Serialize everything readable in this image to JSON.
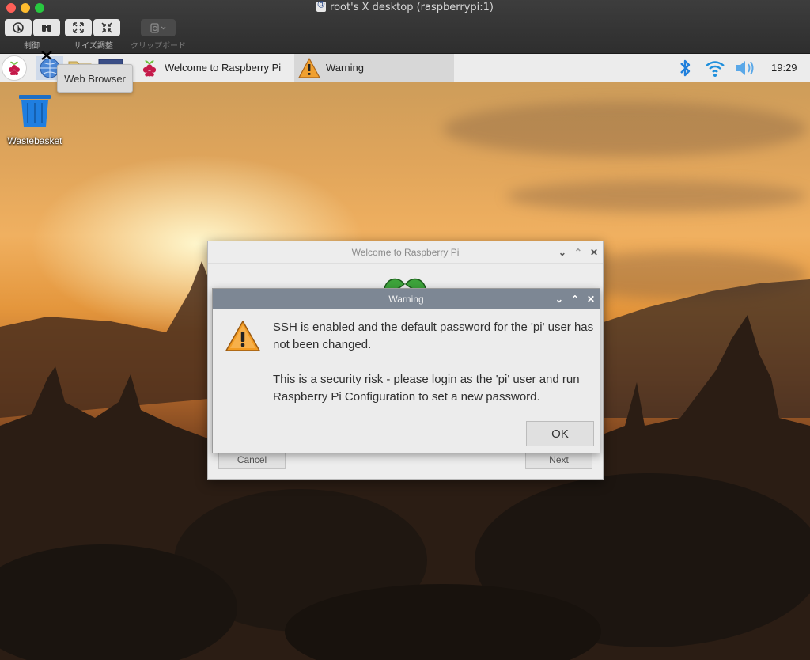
{
  "host_window": {
    "title": "root's X desktop (raspberrypi:1)",
    "toolbar": {
      "control_label": "制御",
      "resize_label": "サイズ調整",
      "clipboard_label": "クリップボード"
    }
  },
  "panel": {
    "tooltip": "Web Browser",
    "tasks": [
      {
        "label": "Welcome to Raspberry Pi"
      },
      {
        "label": "Warning"
      }
    ],
    "clock": "19:29"
  },
  "desktop": {
    "icons": [
      {
        "label": "Wastebasket"
      }
    ]
  },
  "welcome_window": {
    "title": "Welcome to Raspberry Pi",
    "cancel_label": "Cancel",
    "next_label": "Next"
  },
  "warning_dialog": {
    "title": "Warning",
    "message_1": "SSH is enabled and the default password for the 'pi' user has not been changed.",
    "message_2": "This is a security risk - please login as the 'pi' user and run Raspberry Pi Configuration to set a new password.",
    "ok_label": "OK"
  },
  "colors": {
    "warning_titlebar": "#7d8794",
    "bluetooth": "#1f7fdc",
    "wifi": "#1f8fdc"
  }
}
